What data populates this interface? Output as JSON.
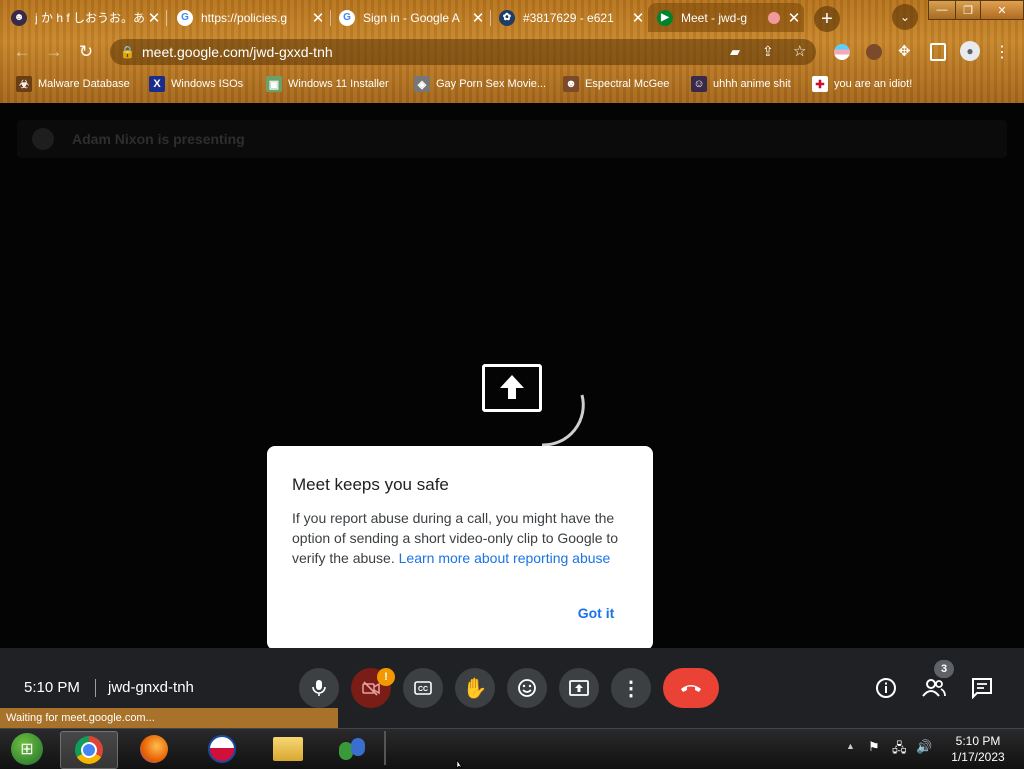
{
  "browser": {
    "tabs": [
      {
        "title": "j か h f しおうお。あ",
        "fav_color": "#3a2a4a",
        "fav_glyph": "☻"
      },
      {
        "title": "https://policies.g",
        "fav_color": "#ffffff",
        "fav_glyph": "G"
      },
      {
        "title": "Sign in - Google A",
        "fav_color": "#ffffff",
        "fav_glyph": "G"
      },
      {
        "title": "#3817629 - e621",
        "fav_color": "#1f3c67",
        "fav_glyph": "✿"
      },
      {
        "title": "Meet - jwd-g",
        "fav_color": "#00832d",
        "fav_glyph": "▶"
      }
    ],
    "new_tab": "+",
    "url": "meet.google.com/jwd-gxxd-tnh",
    "bookmarks": [
      {
        "label": "Malware Database",
        "color": "#6b3d12",
        "glyph": "☣"
      },
      {
        "label": "Windows ISOs",
        "color": "#1a2c8c",
        "glyph": "X"
      },
      {
        "label": "Windows 11 Installer",
        "color": "#6aa06a",
        "glyph": "▣"
      },
      {
        "label": "Gay Porn Sex Movie...",
        "color": "#777777",
        "glyph": "◈"
      },
      {
        "label": "Espectral McGee",
        "color": "#7a4a2a",
        "glyph": "☻"
      },
      {
        "label": "uhhh anime shit",
        "color": "#3a2a4a",
        "glyph": "☺"
      },
      {
        "label": "you are an idiot!",
        "color": "#ffffff",
        "glyph": "✚"
      }
    ]
  },
  "meet": {
    "presenting": "Adam Nixon is presenting",
    "dialog": {
      "title": "Meet keeps you safe",
      "body": "If you report abuse during a call, you might have the option of sending a short video-only clip to Google to verify the abuse.",
      "link": "Learn more about reporting abuse",
      "button": "Got it"
    },
    "clock": "5:10 PM",
    "meeting_code": "jwd-gnxd-tnh",
    "camera_alert": "!",
    "people_count": "3",
    "colors": {
      "end_call": "#ea4335",
      "camera_off": "#7a1d17",
      "link": "#1a73e8"
    }
  },
  "status_bar": "Waiting for meet.google.com...",
  "taskbar": {
    "time": "5:10 PM",
    "date": "1/17/2023",
    "tray_arrow": "▲"
  }
}
